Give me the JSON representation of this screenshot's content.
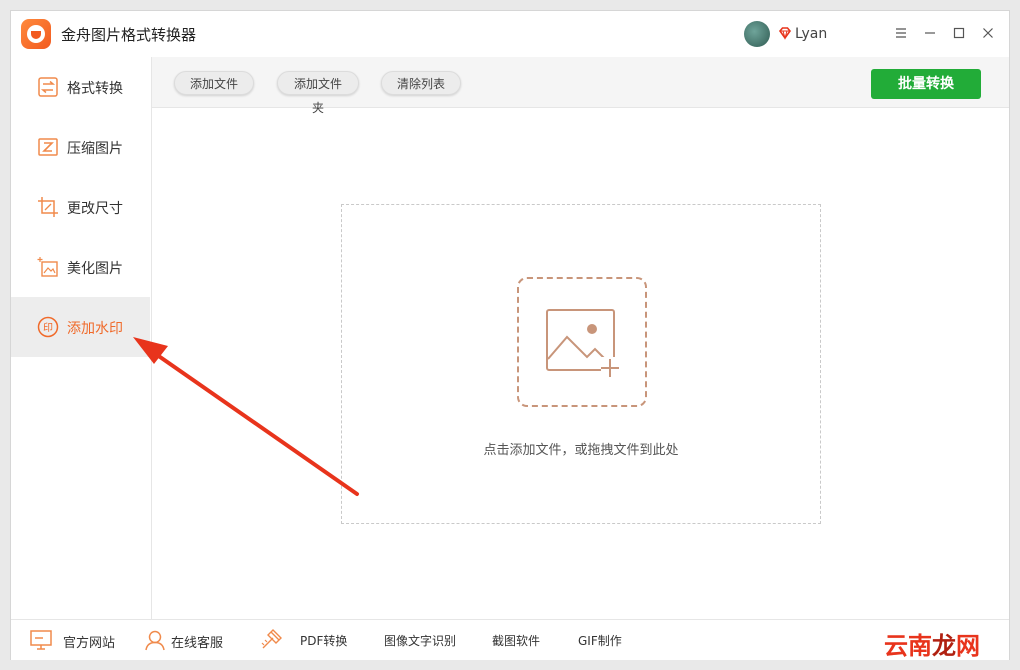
{
  "app": {
    "title": "金舟图片格式转换器",
    "username": "Lyan"
  },
  "window_controls": {
    "menu": "☰",
    "minimize": "—",
    "maximize": "☐",
    "close": "✕"
  },
  "sidebar": {
    "items": [
      {
        "label": "格式转换",
        "icon": "convert-icon",
        "active": false
      },
      {
        "label": "压缩图片",
        "icon": "compress-icon",
        "active": false
      },
      {
        "label": "更改尺寸",
        "icon": "resize-icon",
        "active": false
      },
      {
        "label": "美化图片",
        "icon": "beautify-icon",
        "active": false
      },
      {
        "label": "添加水印",
        "icon": "watermark-icon",
        "active": true
      }
    ]
  },
  "toolbar": {
    "add_file": "添加文件",
    "add_folder": "添加文件夹",
    "clear_list": "清除列表",
    "batch_convert": "批量转换"
  },
  "dropzone": {
    "hint": "点击添加文件，或拖拽文件到此处"
  },
  "footer": {
    "website": "官方网站",
    "support": "在线客服",
    "pdf": "PDF转换",
    "ocr": "图像文字识别",
    "screenshot": "截图软件",
    "gif": "GIF制作"
  },
  "watermark": {
    "part1": "云南",
    "part2": "龙",
    "part3": "网"
  },
  "colors": {
    "accent": "#f06a2a",
    "primary_green": "#22ac38",
    "annotation_red": "#e8341c"
  }
}
